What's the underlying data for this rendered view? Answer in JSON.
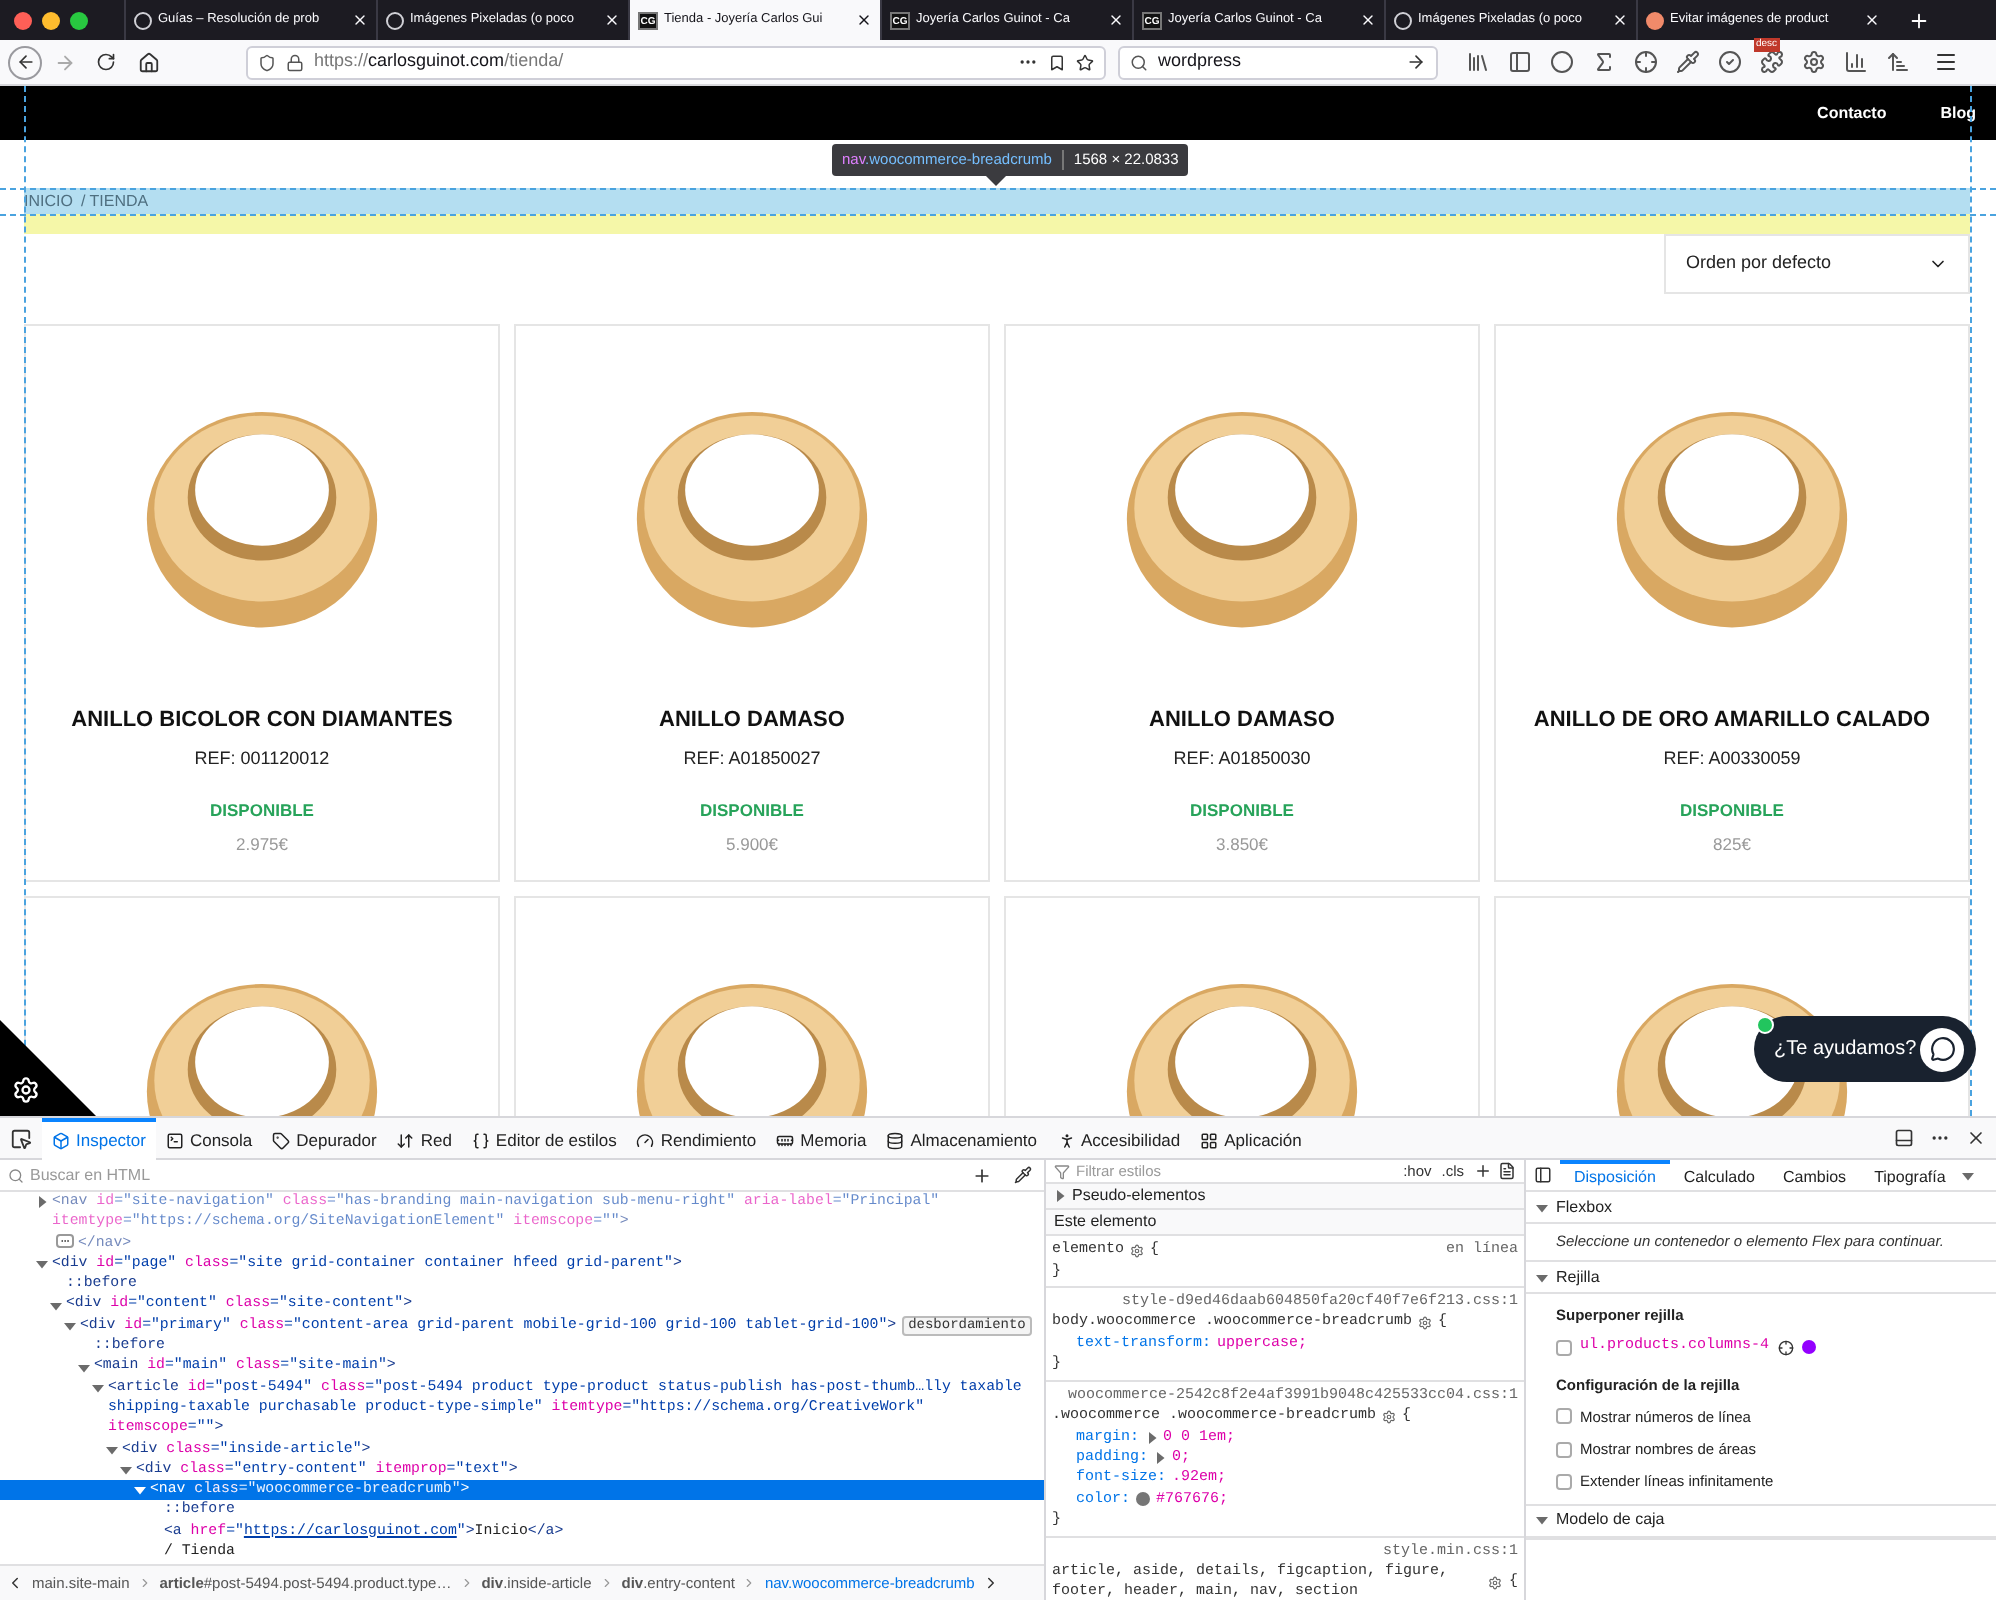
{
  "browser": {
    "tabs": [
      {
        "title": "Guías – Resolución de prob",
        "selected": false,
        "favicon": {
          "kind": "circle"
        }
      },
      {
        "title": "Imágenes Pixeladas (o poco",
        "selected": false,
        "favicon": {
          "kind": "circle"
        }
      },
      {
        "title": "Tienda - Joyería Carlos Gui",
        "selected": true,
        "favicon": {
          "kind": "monogram",
          "text": "CG"
        }
      },
      {
        "title": "Joyería Carlos Guinot - Ca",
        "selected": false,
        "favicon": {
          "kind": "monogram",
          "text": "CG"
        }
      },
      {
        "title": "Joyería Carlos Guinot - Ca",
        "selected": false,
        "favicon": {
          "kind": "monogram",
          "text": "CG"
        }
      },
      {
        "title": "Imágenes Pixeladas (o poco",
        "selected": false,
        "favicon": {
          "kind": "circle"
        }
      },
      {
        "title": "Evitar imágenes de product",
        "selected": false,
        "favicon": {
          "kind": "round"
        }
      }
    ],
    "url": {
      "scheme": "https://",
      "host": "carlosguinot.com",
      "path": "/tienda/"
    },
    "search_value": "wordpress",
    "toolbar_badge": "desc"
  },
  "page": {
    "header_links": [
      "Contacto",
      "Blog"
    ],
    "tooltip": {
      "tag": "nav",
      "classes": ".woocommerce-breadcrumb",
      "size": "1568 × 22.0833"
    },
    "breadcrumb": [
      "INICIO",
      "/ TIENDA"
    ],
    "sort": "Orden por defecto",
    "products": [
      {
        "kind": "full",
        "name": "ANILLO BICOLOR CON DIAMANTES",
        "ref": "REF: 001120012",
        "status": "DISPONIBLE",
        "price": "2.975€"
      },
      {
        "kind": "full",
        "name": "ANILLO DAMASO",
        "ref": "REF: A01850027",
        "status": "DISPONIBLE",
        "price": "5.900€"
      },
      {
        "kind": "full",
        "name": "ANILLO DAMASO",
        "ref": "REF: A01850030",
        "status": "DISPONIBLE",
        "price": "3.850€"
      },
      {
        "kind": "full",
        "name": "ANILLO DE ORO AMARILLO CALADO",
        "ref": "REF: A00330059",
        "status": "DISPONIBLE",
        "price": "825€"
      },
      {
        "kind": "image_only"
      },
      {
        "kind": "image_only"
      },
      {
        "kind": "image_only"
      },
      {
        "kind": "image_only"
      }
    ],
    "chat": "¿Te ayudamos?"
  },
  "devtools": {
    "tabs": [
      {
        "label": "Inspector",
        "selected": true
      },
      {
        "label": "Consola",
        "selected": false
      },
      {
        "label": "Depurador",
        "selected": false
      },
      {
        "label": "Red",
        "selected": false
      },
      {
        "label": "Editor de estilos",
        "selected": false
      },
      {
        "label": "Rendimiento",
        "selected": false
      },
      {
        "label": "Memoria",
        "selected": false
      },
      {
        "label": "Almacenamiento",
        "selected": false
      },
      {
        "label": "Accesibilidad",
        "selected": false
      },
      {
        "label": "Aplicación",
        "selected": false
      }
    ],
    "html_search_placeholder": "Buscar en HTML",
    "html_tree": [
      {
        "selected": false,
        "dimmed": true,
        "expanded": false,
        "tokens": [
          {
            "kind": "tag",
            "t": "<nav"
          },
          {
            "kind": "attr",
            "t": " id"
          },
          {
            "kind": "val",
            "t": "=\"site-navigation\""
          },
          {
            "kind": "attr",
            "t": " class"
          },
          {
            "kind": "val",
            "t": "=\"has-branding main-navigation sub-menu-right\""
          },
          {
            "kind": "attr",
            "t": " aria-label"
          },
          {
            "kind": "val",
            "t": "=\"Principal\""
          },
          {
            "kind": "attr",
            "t": " itemtype"
          },
          {
            "kind": "val",
            "t": "=\"https://schema.org/SiteNavigationElement\""
          },
          {
            "kind": "attr",
            "t": " itemscope"
          },
          {
            "kind": "val",
            "t": "=\"\""
          },
          {
            "kind": "tag",
            "t": ">"
          },
          {
            "kind": "more"
          },
          {
            "kind": "tag",
            "t": "</nav>"
          }
        ]
      },
      {
        "selected": false,
        "dimmed": false,
        "expanded": true,
        "tokens": [
          {
            "kind": "tag",
            "t": "<div"
          },
          {
            "kind": "attr",
            "t": " id"
          },
          {
            "kind": "val",
            "t": "=\"page\""
          },
          {
            "kind": "attr",
            "t": " class"
          },
          {
            "kind": "val",
            "t": "=\"site grid-container container hfeed grid-parent\""
          },
          {
            "kind": "tag",
            "t": ">"
          }
        ],
        "children": [
          {
            "selected": false,
            "dimmed": false,
            "tokens": [
              {
                "kind": "pseudo",
                "t": "::before"
              }
            ]
          },
          {
            "selected": false,
            "dimmed": false,
            "expanded": true,
            "tokens": [
              {
                "kind": "tag",
                "t": "<div"
              },
              {
                "kind": "attr",
                "t": " id"
              },
              {
                "kind": "val",
                "t": "=\"content\""
              },
              {
                "kind": "attr",
                "t": " class"
              },
              {
                "kind": "val",
                "t": "=\"site-content\""
              },
              {
                "kind": "tag",
                "t": ">"
              }
            ],
            "children": [
              {
                "selected": false,
                "dimmed": false,
                "expanded": true,
                "tokens": [
                  {
                    "kind": "tag",
                    "t": "<div"
                  },
                  {
                    "kind": "attr",
                    "t": " id"
                  },
                  {
                    "kind": "val",
                    "t": "=\"primary\""
                  },
                  {
                    "kind": "attr",
                    "t": " class"
                  },
                  {
                    "kind": "val",
                    "t": "=\"content-area grid-parent mobile-grid-100 grid-100 tablet-grid-100\""
                  },
                  {
                    "kind": "tag",
                    "t": ">"
                  },
                  {
                    "kind": "badge",
                    "t": "desbordamiento"
                  }
                ],
                "children": [
                  {
                    "selected": false,
                    "dimmed": false,
                    "tokens": [
                      {
                        "kind": "pseudo",
                        "t": "::before"
                      }
                    ]
                  },
                  {
                    "selected": false,
                    "dimmed": false,
                    "expanded": true,
                    "tokens": [
                      {
                        "kind": "tag",
                        "t": "<main"
                      },
                      {
                        "kind": "attr",
                        "t": " id"
                      },
                      {
                        "kind": "val",
                        "t": "=\"main\""
                      },
                      {
                        "kind": "attr",
                        "t": " class"
                      },
                      {
                        "kind": "val",
                        "t": "=\"site-main\""
                      },
                      {
                        "kind": "tag",
                        "t": ">"
                      }
                    ],
                    "children": [
                      {
                        "selected": false,
                        "dimmed": false,
                        "expanded": true,
                        "tokens": [
                          {
                            "kind": "tag",
                            "t": "<article"
                          },
                          {
                            "kind": "attr",
                            "t": " id"
                          },
                          {
                            "kind": "val",
                            "t": "=\"post-5494\""
                          },
                          {
                            "kind": "attr",
                            "t": " class"
                          },
                          {
                            "kind": "val",
                            "t": "=\"post-5494 product type-product status-publish has-post-thumb…lly taxable shipping-taxable purchasable product-type-simple\""
                          },
                          {
                            "kind": "attr",
                            "t": " itemtype"
                          },
                          {
                            "kind": "val",
                            "t": "=\"https://schema.org/CreativeWork\""
                          },
                          {
                            "kind": "attr",
                            "t": " itemscope"
                          },
                          {
                            "kind": "val",
                            "t": "=\"\""
                          },
                          {
                            "kind": "tag",
                            "t": ">"
                          }
                        ],
                        "children": [
                          {
                            "selected": false,
                            "dimmed": false,
                            "expanded": true,
                            "tokens": [
                              {
                                "kind": "tag",
                                "t": "<div"
                              },
                              {
                                "kind": "attr",
                                "t": " class"
                              },
                              {
                                "kind": "val",
                                "t": "=\"inside-article\""
                              },
                              {
                                "kind": "tag",
                                "t": ">"
                              }
                            ],
                            "children": [
                              {
                                "selected": false,
                                "dimmed": false,
                                "expanded": true,
                                "tokens": [
                                  {
                                    "kind": "tag",
                                    "t": "<div"
                                  },
                                  {
                                    "kind": "attr",
                                    "t": " class"
                                  },
                                  {
                                    "kind": "val",
                                    "t": "=\"entry-content\""
                                  },
                                  {
                                    "kind": "attr",
                                    "t": " itemprop"
                                  },
                                  {
                                    "kind": "val",
                                    "t": "=\"text\""
                                  },
                                  {
                                    "kind": "tag",
                                    "t": ">"
                                  }
                                ],
                                "children": [
                                  {
                                    "selected": true,
                                    "dimmed": false,
                                    "expanded": true,
                                    "tokens": [
                                      {
                                        "kind": "tag",
                                        "t": "<nav"
                                      },
                                      {
                                        "kind": "attr",
                                        "t": " class"
                                      },
                                      {
                                        "kind": "val",
                                        "t": "=\"woocommerce-breadcrumb\""
                                      },
                                      {
                                        "kind": "tag",
                                        "t": ">"
                                      }
                                    ],
                                    "children": [
                                      {
                                        "selected": false,
                                        "dimmed": false,
                                        "tokens": [
                                          {
                                            "kind": "pseudo",
                                            "t": "::before"
                                          }
                                        ]
                                      },
                                      {
                                        "selected": false,
                                        "dimmed": false,
                                        "tokens": [
                                          {
                                            "kind": "tag",
                                            "t": "<a"
                                          },
                                          {
                                            "kind": "attr",
                                            "t": " href"
                                          },
                                          {
                                            "kind": "val",
                                            "t": "=\""
                                          },
                                          {
                                            "kind": "link",
                                            "t": "https://carlosguinot.com"
                                          },
                                          {
                                            "kind": "val",
                                            "t": "\""
                                          },
                                          {
                                            "kind": "tag",
                                            "t": ">"
                                          },
                                          {
                                            "kind": "plain",
                                            "t": "Inicio"
                                          },
                                          {
                                            "kind": "tag",
                                            "t": "</a>"
                                          }
                                        ]
                                      },
                                      {
                                        "selected": false,
                                        "dimmed": false,
                                        "tokens": [
                                          {
                                            "kind": "plain",
                                            "t": "/ Tienda"
                                          }
                                        ]
                                      }
                                    ]
                                  }
                                ]
                              }
                            ]
                          }
                        ]
                      }
                    ]
                  }
                ]
              }
            ]
          }
        ]
      }
    ],
    "breadcrumbs": [
      {
        "label": "main.site-main",
        "selected": false
      },
      {
        "label": "**article**#post-5494.post-5494.product.type…",
        "selected": false
      },
      {
        "label": "**div**.inside-article",
        "selected": false
      },
      {
        "label": "**div**.entry-content",
        "selected": false
      },
      {
        "label": "nav.woocommerce-breadcrumb",
        "selected": true
      }
    ],
    "styles": {
      "filter_placeholder": "Filtrar estilos",
      "hov": ":hov",
      "cls": ".cls",
      "pseudo_label": "Pseudo-elementos",
      "pseudo_expanded": false,
      "element_header": "Este elemento",
      "rules": [
        {
          "kind": "inline",
          "selector": "elemento",
          "source": "en línea",
          "open": "{",
          "close": "}"
        },
        {
          "kind": "sheet",
          "source": "style-d9ed46daab604850fa20cf40f7e6f213.css:1",
          "selector": "body.woocommerce .woocommerce-breadcrumb",
          "open": "{",
          "close": "}",
          "declarations": [
            {
              "name": "text-transform:",
              "value": "uppercase;",
              "expandable": false
            }
          ]
        },
        {
          "kind": "sheet",
          "source": "woocommerce-2542c8f2e4af3991b9048c425533cc04.css:1",
          "selector": ".woocommerce .woocommerce-breadcrumb",
          "open": "{",
          "close": "}",
          "declarations": [
            {
              "name": "margin:",
              "value": "0 0 1em;",
              "expandable": true
            },
            {
              "name": "padding:",
              "value": "0;",
              "expandable": true
            },
            {
              "name": "font-size:",
              "value": ".92em;",
              "expandable": false
            },
            {
              "name": "color:",
              "value": "#767676;",
              "expandable": false,
              "color": "#767676"
            }
          ]
        },
        {
          "kind": "sheet",
          "source": "style.min.css:1",
          "selector": "article, aside, details, figcaption, figure, footer, header, main, nav, section",
          "open": "{"
        }
      ]
    },
    "layout_panel": {
      "tabs": [
        {
          "label": "Disposición",
          "selected": true
        },
        {
          "label": "Calculado",
          "selected": false
        },
        {
          "label": "Cambios",
          "selected": false
        },
        {
          "label": "Tipografía",
          "selected": false
        }
      ],
      "sections": [
        {
          "kind": "note",
          "title": "Flexbox",
          "expanded": true,
          "note": "Seleccione un contenedor o elemento Flex para continuar."
        },
        {
          "kind": "grid",
          "title": "Rejilla",
          "expanded": true,
          "overlay_heading": "Superponer rejilla",
          "overlays": [
            {
              "label": "ul.products.columns-4",
              "checked": false,
              "color": "#9400ff"
            }
          ],
          "settings_heading": "Configuración de la rejilla",
          "settings": [
            {
              "label": "Mostrar números de línea",
              "checked": false
            },
            {
              "label": "Mostrar nombres de áreas",
              "checked": false
            },
            {
              "label": "Extender líneas infinitamente",
              "checked": false
            }
          ]
        },
        {
          "kind": "empty",
          "title": "Modelo de caja",
          "expanded": true
        }
      ]
    }
  }
}
